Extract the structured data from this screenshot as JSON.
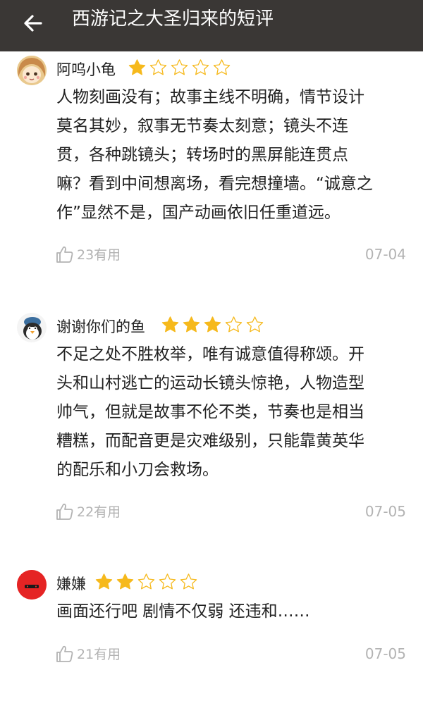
{
  "header": {
    "title": "西游记之大圣归来的短评",
    "back_icon": "arrow-left-icon",
    "background": "#3a3735"
  },
  "colors": {
    "star_filled": "#f6b91c",
    "star_empty": "#f6b91c",
    "muted_text": "#b3b3b3"
  },
  "reviews": [
    {
      "username": "阿呜小龟",
      "rating": 1,
      "max_rating": 5,
      "avatar": "cartoon-girl-avatar",
      "lines": [
        "人物刻画没有；故事主线不明确，情节设计",
        "莫名其妙，叙事无节奏太刻意；镜头不连",
        "贯，各种跳镜头；转场时的黑屏能连贯点",
        "嘛？看到中间想离场，看完想撞墙。“诚意之",
        "作”显然不是，国产动画依旧任重道远。"
      ],
      "useful_label": "23有用",
      "date": "07-04"
    },
    {
      "username": "谢谢你们的鱼",
      "rating": 3,
      "max_rating": 5,
      "avatar": "penguin-avatar",
      "lines": [
        "不足之处不胜枚举，唯有诚意值得称颂。开",
        "头和山村逃亡的运动长镜头惊艳，人物造型",
        "帅气，但就是故事不伦不类，节奏也是相当",
        "糟糕，而配音更是灾难级别，只能靠黄英华",
        "的配乐和小刀会救场。"
      ],
      "useful_label": "22有用",
      "date": "07-05"
    },
    {
      "username": "嫌嫌",
      "rating": 2,
      "max_rating": 5,
      "avatar": "red-face-avatar",
      "lines": [
        "画面还行吧 剧情不仅弱 还违和……"
      ],
      "useful_label": "21有用",
      "date": "07-05"
    }
  ]
}
